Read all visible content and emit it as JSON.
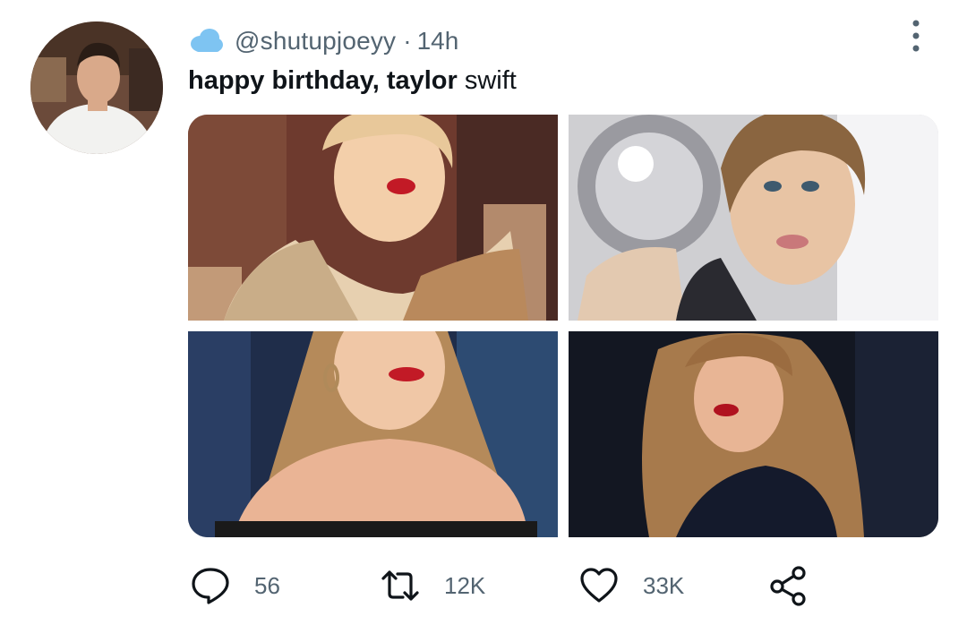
{
  "tweet": {
    "handle": "@shutupjoeyy",
    "separator": "·",
    "time": "14h",
    "text_bold": "happy birthday, taylor",
    "text_rest": " swift",
    "badge_icon": "cloud-icon",
    "menu_icon": "more-vertical-icon"
  },
  "media": {
    "photos": [
      {
        "name": "photo-1"
      },
      {
        "name": "photo-2"
      },
      {
        "name": "photo-3"
      },
      {
        "name": "photo-4"
      }
    ]
  },
  "actions": {
    "reply_count": "56",
    "retweet_count": "12K",
    "like_count": "33K",
    "reply_icon": "reply-icon",
    "retweet_icon": "retweet-icon",
    "like_icon": "heart-icon",
    "share_icon": "share-icon"
  },
  "colors": {
    "text": "#0f1419",
    "secondary": "#536471",
    "cloud": "#7ec4f2"
  }
}
